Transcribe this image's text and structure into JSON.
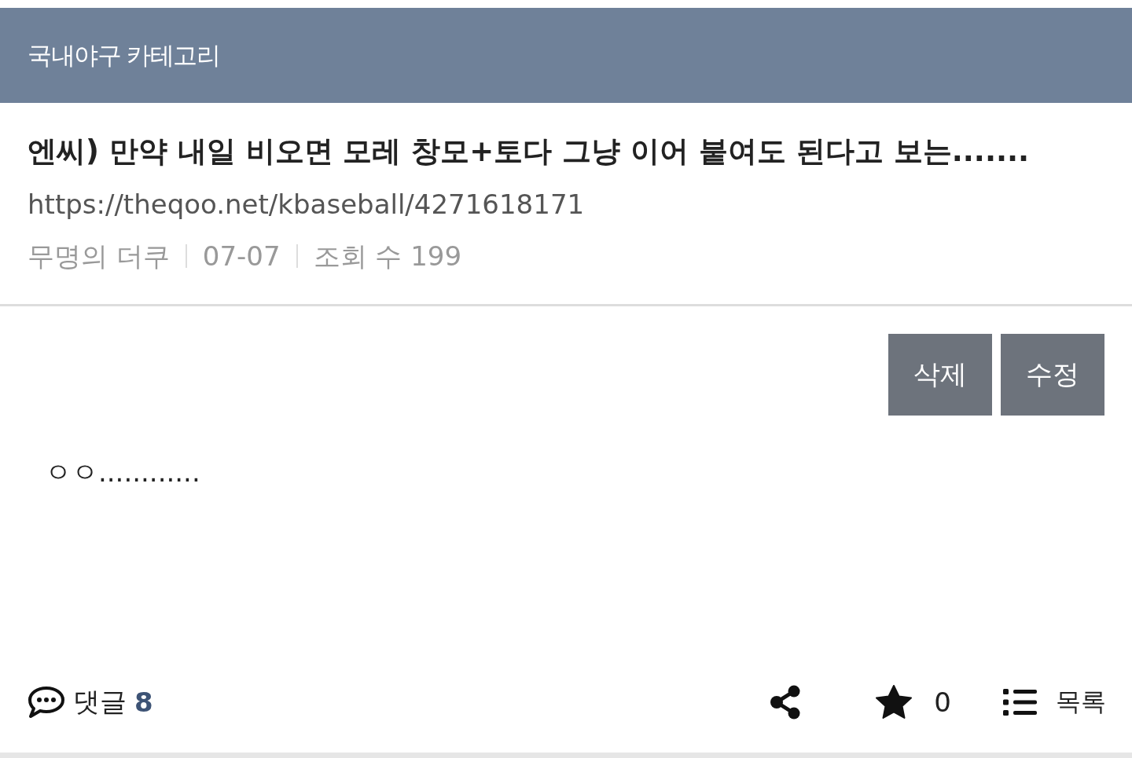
{
  "header": {
    "title": "국내야구 카테고리"
  },
  "post": {
    "title": "엔씨) 만약 내일 비오면 모레 창모+토다 그냥 이어 붙여도 된다고 보는.......",
    "url": "https://theqoo.net/kbaseball/4271618171",
    "meta": [
      "무명의 더쿠",
      "07-07",
      "조회 수 199"
    ],
    "actions": [
      "삭제",
      "수정"
    ],
    "body": "ㅇㅇ............"
  },
  "footer": {
    "comments_label": "댓글",
    "comments_count": "8",
    "star_count": "0",
    "list_label": "목록"
  }
}
